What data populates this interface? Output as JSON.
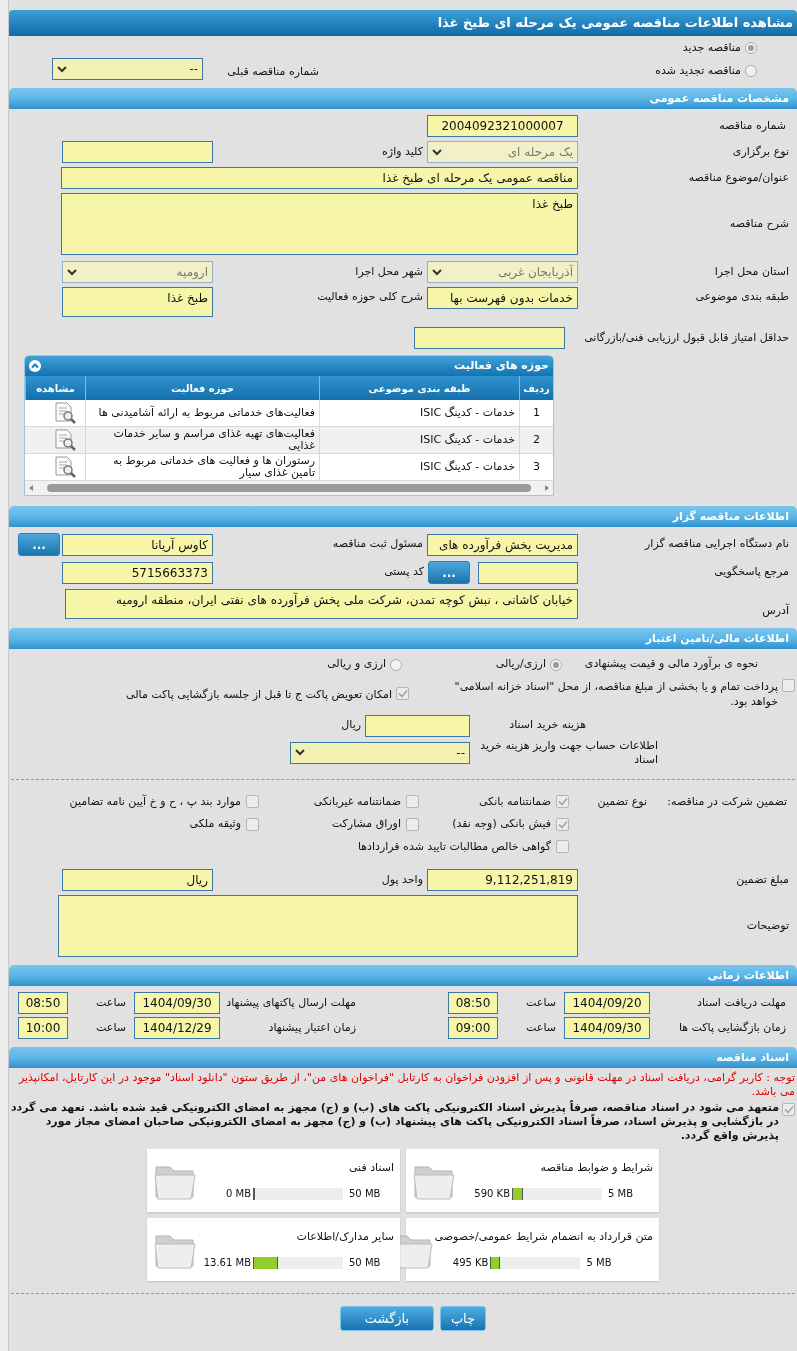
{
  "title": "مشاهده اطلاعات مناقصه عمومی یک مرحله ای طبخ غذا",
  "tender_type": [
    {
      "label": "مناقصه جدید",
      "selected": true
    },
    {
      "label": "مناقصه تجدید شده",
      "selected": false
    }
  ],
  "previous_tender": {
    "label": "شماره مناقصه قبلی",
    "value": "--",
    "disabled": false
  },
  "general": {
    "heading": "مشخصات مناقصه عمومی",
    "tender_number": {
      "label": "شماره مناقصه",
      "value": "2004092321000007"
    },
    "holding_type": {
      "label": "نوع برگزاری",
      "value": "یک مرحله ای",
      "disabled": true
    },
    "keyword": {
      "label": "کلید واژه"
    },
    "subject": {
      "label": "عنوان/موضوع مناقصه",
      "value": "مناقصه عمومی یک مرحله ای طبخ غذا"
    },
    "description": {
      "label": "شرح مناقصه",
      "value": "طبخ غذا"
    },
    "province": {
      "label": "استان محل اجرا",
      "value": "آذربایجان غربی",
      "disabled": true
    },
    "city": {
      "label": "شهر محل اجرا",
      "value": "ارومیه",
      "disabled": true
    },
    "category": {
      "label": "طبقه بندی موضوعی",
      "value": "خدمات بدون فهرست بها"
    },
    "activity_scope": {
      "label": "شرح کلی حوزه فعالیت",
      "value": "طبخ غذا"
    },
    "min_score": {
      "label": "حداقل امتیاز قابل قبول ارزیابی فنی/بازرگانی"
    }
  },
  "activities": {
    "title": "حوزه های فعالیت",
    "columns": [
      "ردیف",
      "طبقه بندی موضوعی",
      "حوزه فعالیت",
      "مشاهده"
    ],
    "rows": [
      {
        "index": "1",
        "category": "خدمات - کدینگ ISIC",
        "scope": "فعالیت‌های خدماتی مربوط به ارائه آشامیدنی ها"
      },
      {
        "index": "2",
        "category": "خدمات - کدینگ ISIC",
        "scope": "فعالیت‌های تهیه غذای مراسم و سایر خدمات غذایی"
      },
      {
        "index": "3",
        "category": "خدمات - کدینگ ISIC",
        "scope": "رستوران ها و فعالیت های خدماتی مربوط به تامین غذای سیار"
      }
    ]
  },
  "organizer": {
    "heading": "اطلاعات مناقصه گزار",
    "agency": {
      "label": "نام دستگاه اجرایی مناقصه گزار",
      "value": "مدیریت پخش فرآورده های"
    },
    "registrar": {
      "label": "مسئول ثبت مناقصه",
      "value": "کاوس آریانا",
      "button": "..."
    },
    "reference": {
      "label": "مرجع پاسخگویی",
      "button": "..."
    },
    "postal_code": {
      "label": "کد پستی",
      "value": "5715663373"
    },
    "address": {
      "label": "آدرس",
      "value": "خیابان کاشانی ، نبش کوچه تمدن، شرکت ملی پخش فرآورده های نفتی ایران، منطقه ارومیه"
    }
  },
  "financial": {
    "heading": "اطلاعات مالی/تامین اعتبار",
    "estimate": {
      "label": "نحوه ی برآورد مالی و قیمت پیشنهادی",
      "options": [
        {
          "label": "ارزی/ریالی",
          "selected": true
        },
        {
          "label": "ارزی و ریالی",
          "selected": false
        }
      ]
    },
    "options": [
      {
        "label": "پرداخت تمام و یا بخشی از مبلغ مناقصه، از محل \"اسناد خزانه اسلامی\" خواهد بود.",
        "checked": false
      },
      {
        "label": "امکان تعویض پاکت ج تا قبل از جلسه بازگشایی پاکت مالی",
        "checked": true
      }
    ],
    "doc_cost": {
      "label": "هزینه خرید اسناد",
      "unit": "ریال"
    },
    "account": {
      "label": "اطلاعات حساب جهت واریز هزینه خرید اسناد",
      "value": "--",
      "disabled": false
    }
  },
  "guarantee": {
    "label": "تضمین شرکت در مناقصه:",
    "type_label": "نوع تضمین",
    "types": [
      {
        "label": "ضمانتنامه بانکی",
        "checked": true
      },
      {
        "label": "ضمانتنامه غیربانکی",
        "checked": false
      },
      {
        "label": "موارد بند پ ، ح و خ آیین نامه تضامین",
        "checked": false
      },
      {
        "label": "فیش بانکی (وجه نقد)",
        "checked": true
      },
      {
        "label": "اوراق مشارکت",
        "checked": false
      },
      {
        "label": "وثیقه ملکی",
        "checked": false
      },
      {
        "label": "گواهی خالص مطالبات تایید شده قراردادها",
        "checked": false
      }
    ],
    "amount": {
      "label": "مبلغ تضمین",
      "value": "9,112,251,819"
    },
    "currency": {
      "label": "واحد پول",
      "value": "ریال"
    },
    "notes": {
      "label": "توضیحات"
    }
  },
  "timing": {
    "heading": "اطلاعات زمانی",
    "items": [
      {
        "label": "مهلت دریافت اسناد",
        "date": "1404/09/20",
        "time_label": "ساعت",
        "time": "08:50"
      },
      {
        "label": "مهلت ارسال پاکتهای پیشنهاد",
        "date": "1404/09/30",
        "time_label": "ساعت",
        "time": "08:50"
      },
      {
        "label": "زمان بازگشایی پاکت ها",
        "date": "1404/09/30",
        "time_label": "ساعت",
        "time": "09:00"
      },
      {
        "label": "زمان اعتبار پیشنهاد",
        "date": "1404/12/29",
        "time_label": "ساعت",
        "time": "10:00"
      }
    ]
  },
  "documents": {
    "heading": "اسناد مناقصه",
    "notice": "توجه : کاربر گرامی، دریافت اسناد در مهلت قانونی و پس از افزودن فراخوان به کارتابل \"فراخوان های من\"، از طریق ستون \"دانلود اسناد\" موجود در این کارتابل، امکانپذیر می باشد.",
    "commitment": {
      "label": "متعهد می شود در اسناد مناقصه، صرفاً پذیرش اسناد الکترونیکی پاکت های (ب) و (ج) مجهز به امضای الکترونیکی قید شده باشد. تعهد می گردد در بازگشایی و پذیرش اسناد، صرفاً اسناد الکترونیکی پاکت های پیشنهاد (ب) و (ج) مجهز به امضای الکترونیکی صاحبان امضای مجاز مورد پذیرش واقع گردد.",
      "checked": true
    },
    "files": [
      {
        "name": "شرایط و ضوابط مناقصه",
        "used": "590 KB",
        "max": "5 MB",
        "level": 0.115
      },
      {
        "name": "اسناد فنی",
        "used": "0 MB",
        "max": "50 MB",
        "level": 0
      },
      {
        "name": "متن قرارداد به انضمام شرایط عمومی/خصوصی",
        "used": "495 KB",
        "max": "5 MB",
        "level": 0.097
      },
      {
        "name": "سایر مدارک/اطلاعات",
        "used": "13.61 MB",
        "max": "50 MB",
        "level": 0.272
      }
    ]
  },
  "buttons": [
    "چاپ",
    "بازگشت"
  ]
}
